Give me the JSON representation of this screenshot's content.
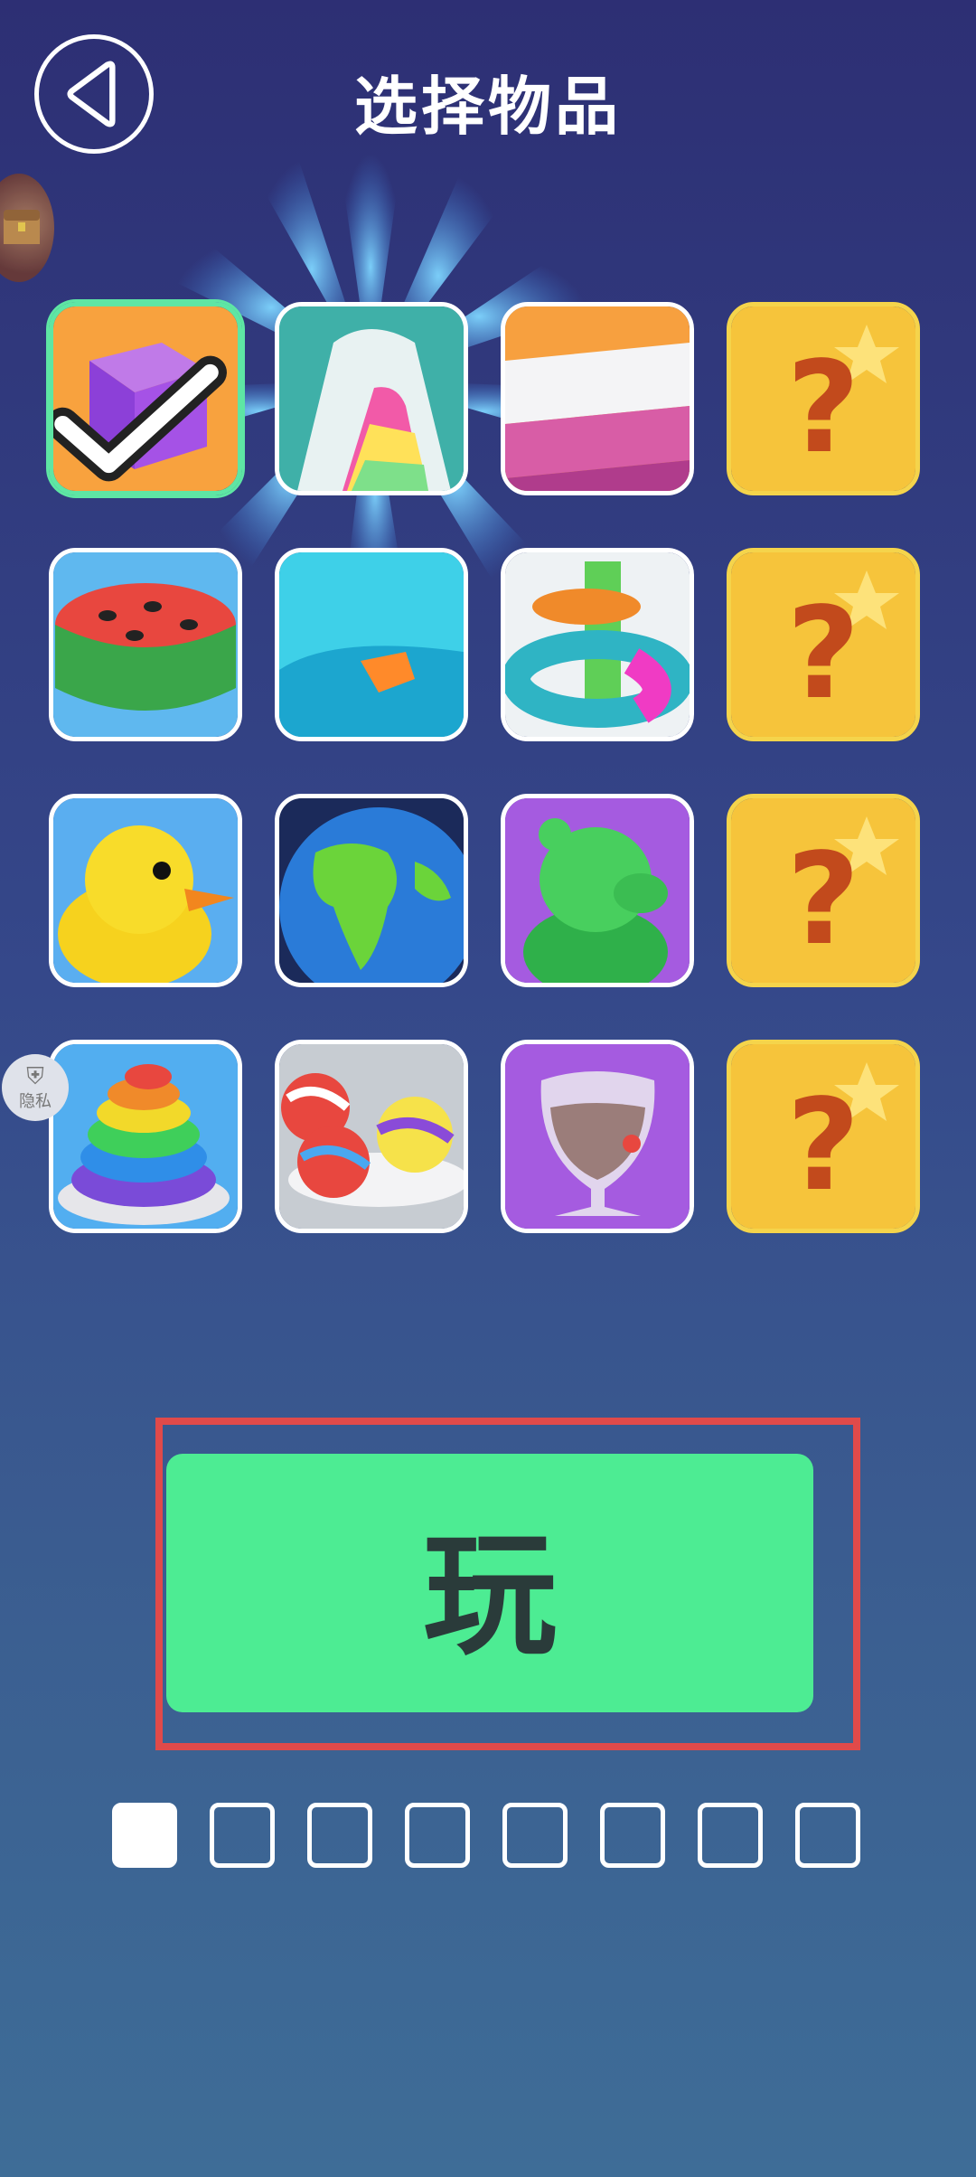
{
  "header": {
    "title": "选择物品",
    "back_icon": "back-arrow-icon"
  },
  "items": [
    {
      "name": "purple-cube",
      "selected": true,
      "locked": false
    },
    {
      "name": "rainbow-arch",
      "selected": false,
      "locked": false
    },
    {
      "name": "pink-block",
      "selected": false,
      "locked": false
    },
    {
      "name": "mystery",
      "selected": false,
      "locked": true,
      "mark": "?"
    },
    {
      "name": "watermelon",
      "selected": false,
      "locked": false
    },
    {
      "name": "water-slide",
      "selected": false,
      "locked": false
    },
    {
      "name": "ring-stack",
      "selected": false,
      "locked": false
    },
    {
      "name": "mystery",
      "selected": false,
      "locked": true,
      "mark": "?"
    },
    {
      "name": "rubber-duck",
      "selected": false,
      "locked": false
    },
    {
      "name": "earth-globe",
      "selected": false,
      "locked": false
    },
    {
      "name": "green-bear",
      "selected": false,
      "locked": false
    },
    {
      "name": "mystery",
      "selected": false,
      "locked": true,
      "mark": "?"
    },
    {
      "name": "rainbow-swirl",
      "selected": false,
      "locked": false
    },
    {
      "name": "beach-balls",
      "selected": false,
      "locked": false
    },
    {
      "name": "smoothie-glass",
      "selected": false,
      "locked": false
    },
    {
      "name": "mystery",
      "selected": false,
      "locked": true,
      "mark": "?"
    }
  ],
  "privacy_badge": {
    "label": "隐私"
  },
  "play_button": {
    "label": "玩"
  },
  "pagination": {
    "total": 8,
    "current": 1
  },
  "colors": {
    "play": "#4dec93",
    "highlight": "#e04a4a",
    "selected_border": "#5ee6a4",
    "locked": "#f5c53a"
  }
}
